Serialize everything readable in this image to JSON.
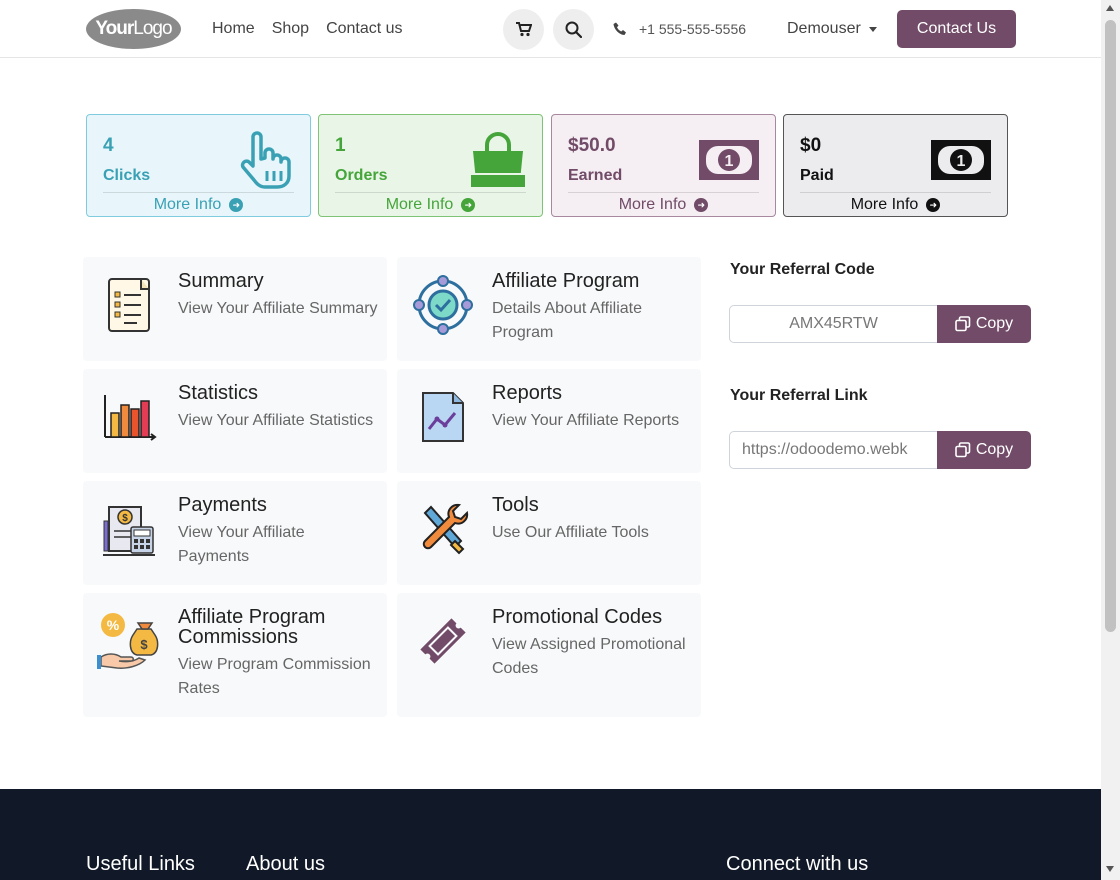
{
  "header": {
    "logo": {
      "part1": "Your",
      "part2": "Logo"
    },
    "nav": [
      {
        "label": "Home"
      },
      {
        "label": "Shop"
      },
      {
        "label": "Contact us"
      }
    ],
    "phone": "+1 555-555-5556",
    "user": "Demouser",
    "contact_button": "Contact Us"
  },
  "cards": [
    {
      "value": "4",
      "label": "Clicks",
      "more": "More Info",
      "color": "#3aa1b5",
      "bg": "#e8f6fb",
      "border": "#7fcbe0",
      "icon": "pointer-hand-icon"
    },
    {
      "value": "1",
      "label": "Orders",
      "more": "More Info",
      "color": "#45a53b",
      "bg": "#e9f6e7",
      "border": "#7fc476",
      "icon": "shopping-bag-icon"
    },
    {
      "value": "$50.0",
      "label": "Earned",
      "more": "More Info",
      "color": "#714b67",
      "bg": "#f5eef3",
      "border": "#a7889e",
      "icon": "banknote-icon"
    },
    {
      "value": "$0",
      "label": "Paid",
      "more": "More Info",
      "color": "#111111",
      "bg": "#ececef",
      "border": "#555555",
      "icon": "banknote-icon"
    }
  ],
  "tiles": [
    {
      "title": "Summary",
      "desc": "View Your Affiliate Summary",
      "icon": "checklist-icon"
    },
    {
      "title": "Affiliate Program",
      "desc": "Details About Affiliate Program",
      "icon": "network-check-icon"
    },
    {
      "title": "Statistics",
      "desc": "View Your Affiliate Statistics",
      "icon": "bar-chart-icon"
    },
    {
      "title": "Reports",
      "desc": "View Your Affiliate Reports",
      "icon": "report-chart-icon"
    },
    {
      "title": "Payments",
      "desc": "View Your Affiliate Payments",
      "icon": "invoice-calculator-icon"
    },
    {
      "title": "Tools",
      "desc": "Use Our Affiliate Tools",
      "icon": "wrench-screwdriver-icon"
    },
    {
      "title": "Affiliate Program Commissions",
      "desc": "View Program Commission Rates",
      "icon": "commission-hand-icon"
    },
    {
      "title": "Promotional Codes",
      "desc": "View Assigned Promotional Codes",
      "icon": "ticket-icon"
    }
  ],
  "referral": {
    "code_title": "Your Referral Code",
    "code_value": "AMX45RTW",
    "link_title": "Your Referral Link",
    "link_value": "https://odoodemo.webk",
    "copy_label": "Copy"
  },
  "footer": {
    "useful_links": "Useful Links",
    "about_us": "About us",
    "connect": "Connect with us"
  }
}
